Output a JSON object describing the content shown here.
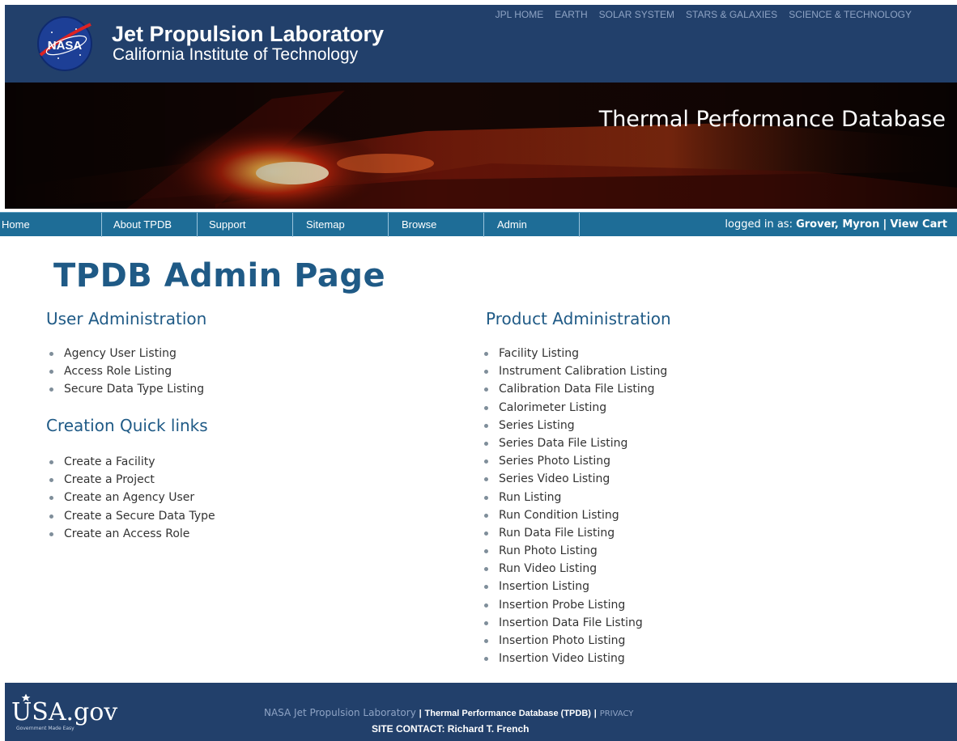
{
  "header": {
    "title": "Jet Propulsion Laboratory",
    "subtitle": "California Institute of Technology",
    "logo_text": "NASA",
    "top_links": [
      "JPL HOME",
      "EARTH",
      "SOLAR SYSTEM",
      "STARS & GALAXIES",
      "SCIENCE & TECHNOLOGY"
    ]
  },
  "banner": {
    "title": "Thermal Performance Database"
  },
  "nav": {
    "items": [
      "Home",
      "About TPDB",
      "Support",
      "Sitemap",
      "Browse",
      "Admin"
    ],
    "login_prefix": "logged in as:",
    "user_name": "Grover, Myron",
    "separator": "|",
    "view_cart": "View Cart"
  },
  "main": {
    "page_title": "TPDB Admin Page",
    "user_admin": {
      "title": "User Administration",
      "links": [
        "Agency User Listing",
        "Access Role Listing",
        "Secure Data Type Listing"
      ]
    },
    "creation": {
      "title": "Creation Quick links",
      "links": [
        "Create a Facility",
        "Create a Project",
        "Create an Agency User",
        "Create a Secure Data Type",
        "Create an Access Role"
      ]
    },
    "product_admin": {
      "title": "Product Administration",
      "links": [
        "Facility Listing",
        "Instrument Calibration Listing",
        "Calibration Data File Listing",
        "Calorimeter Listing",
        "Series Listing",
        "Series Data File Listing",
        "Series Photo Listing",
        "Series Video Listing",
        "Run Listing",
        "Run Condition Listing",
        "Run Data File Listing",
        "Run Photo Listing",
        "Run Video Listing",
        "Insertion Listing",
        "Insertion Probe Listing",
        "Insertion Data File Listing",
        "Insertion Photo Listing",
        "Insertion Video Listing"
      ]
    }
  },
  "footer": {
    "logo_text": "USA.gov",
    "logo_tagline": "Government Made Easy",
    "jpl_link": "NASA Jet Propulsion Laboratory",
    "sep": "|",
    "tpdb_text": "Thermal Performance Database (TPDB)",
    "privacy": "PRIVACY",
    "contact": "SITE CONTACT: Richard T. French"
  },
  "colors": {
    "header_bg": "#22406b",
    "nav_bg": "#1e6d97",
    "heading": "#1f5a86",
    "footer_bg": "#22406b"
  }
}
